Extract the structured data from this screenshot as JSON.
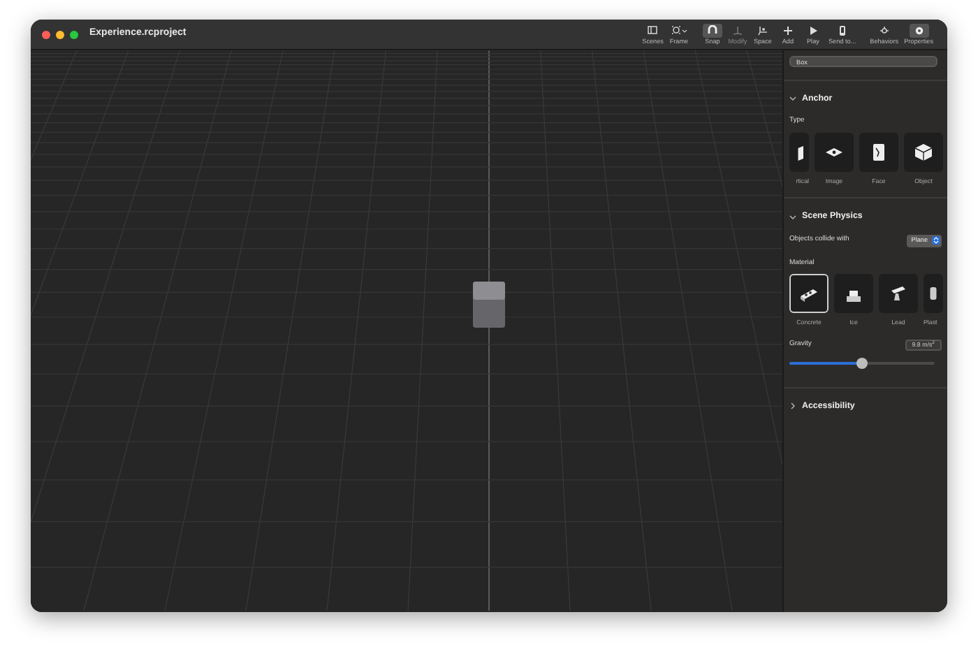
{
  "window": {
    "title": "Experience.rcproject"
  },
  "toolbar": [
    {
      "label": "Scenes",
      "kind": "scenes",
      "selected": false,
      "disabled": false
    },
    {
      "label": "Frame",
      "kind": "frame",
      "selected": false,
      "disabled": false
    },
    {
      "label": "Snap",
      "kind": "snap",
      "selected": true,
      "disabled": false
    },
    {
      "label": "Modify",
      "kind": "modify",
      "selected": false,
      "disabled": true
    },
    {
      "label": "Space",
      "kind": "space",
      "selected": false,
      "disabled": false
    },
    {
      "label": "Add",
      "kind": "add",
      "selected": false,
      "disabled": false
    },
    {
      "label": "Play",
      "kind": "play",
      "selected": false,
      "disabled": false
    },
    {
      "label": "Send to...",
      "kind": "send",
      "selected": false,
      "disabled": false
    },
    {
      "label": "Behaviors",
      "kind": "behaviors",
      "selected": false,
      "disabled": false
    },
    {
      "label": "Properties",
      "kind": "properties",
      "selected": true,
      "disabled": false
    }
  ],
  "inspector": {
    "name_field": {
      "value": "Box"
    },
    "sections": [
      {
        "title": "Anchor",
        "expanded": true,
        "type_label": "Type",
        "types": [
          {
            "label": "rtical",
            "kind": "vertical",
            "clipped": true
          },
          {
            "label": "Image",
            "kind": "image"
          },
          {
            "label": "Face",
            "kind": "face"
          },
          {
            "label": "Object",
            "kind": "object"
          }
        ]
      },
      {
        "title": "Scene Physics",
        "expanded": true,
        "collide_label": "Objects collide with",
        "collide_value": "Plane",
        "material_label": "Material",
        "materials": [
          {
            "label": "Concrete",
            "kind": "concrete",
            "selected": true
          },
          {
            "label": "Ice",
            "kind": "ice",
            "selected": false
          },
          {
            "label": "Lead",
            "kind": "lead",
            "selected": false
          },
          {
            "label": "Plast",
            "kind": "plastic",
            "selected": false,
            "clipped": true
          }
        ],
        "gravity_label": "Gravity",
        "gravity_value": "9.8 m/s$^{2}$",
        "gravity_slider": {
          "level": 0.5
        }
      },
      {
        "title": "Accessibility",
        "expanded": false
      }
    ]
  }
}
